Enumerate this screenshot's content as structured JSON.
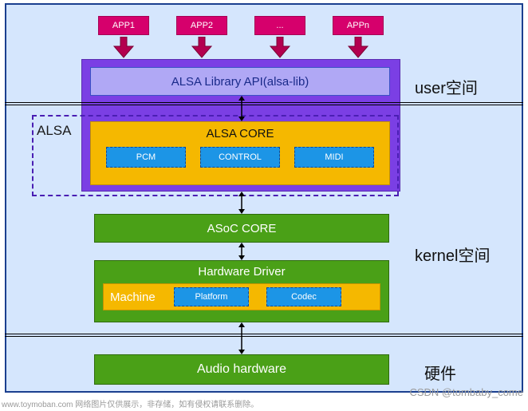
{
  "apps": [
    "APP1",
    "APP2",
    "...",
    "APPn"
  ],
  "alsa_region_label": "ALSA",
  "library_api": "ALSA Library API(alsa-lib)",
  "alsa_core": {
    "title": "ALSA CORE",
    "modules": [
      "PCM",
      "CONTROL",
      "MIDI"
    ]
  },
  "asoc_core": "ASoC CORE",
  "hardware_driver": {
    "title": "Hardware Driver",
    "machine_label": "Machine",
    "modules": [
      "Platform",
      "Codec"
    ]
  },
  "audio_hardware": "Audio hardware",
  "sections": {
    "user_space": "user空间",
    "kernel_space": "kernel空间",
    "hardware": "硬件"
  },
  "watermark_left": "www.toymoban.com  网络图片仅供展示，非存储，如有侵权请联系删除。",
  "watermark_right": "CSDN @tombaby_come",
  "colors": {
    "canvas_bg": "#d5e6fd",
    "app_bg": "#d6006c",
    "purple_bg": "#7b3fe4",
    "lib_bg": "#b0a8f5",
    "yellow_bg": "#f5b800",
    "blue_mod_bg": "#1c95e6",
    "green_bg": "#4aa017"
  }
}
